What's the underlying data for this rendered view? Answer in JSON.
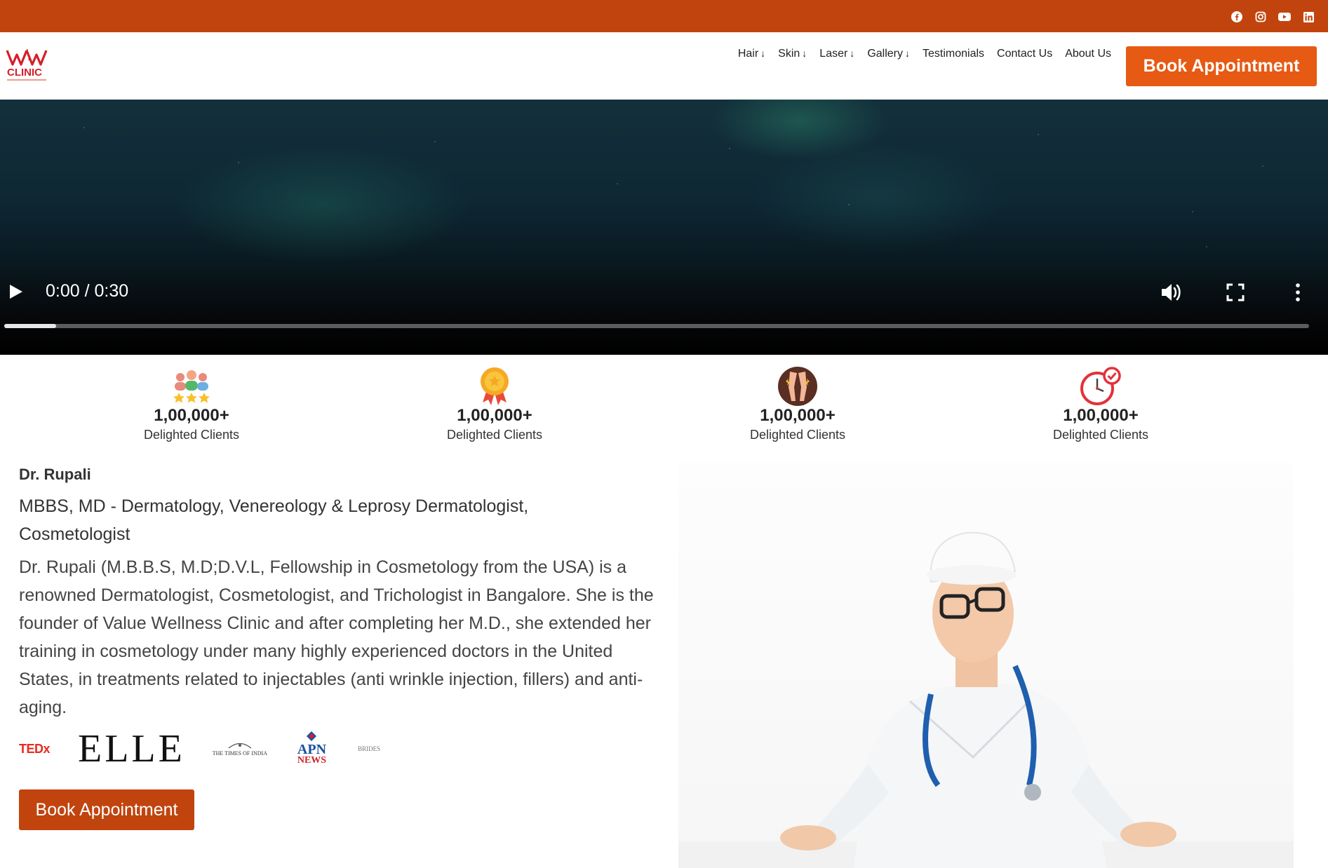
{
  "top_bar": {
    "color": "#c1440e",
    "social_icons": [
      "facebook-icon",
      "instagram-icon",
      "youtube-icon",
      "linkedin-icon"
    ]
  },
  "header": {
    "logo_text": "VW CLINIC",
    "nav": [
      {
        "label": "Hair",
        "dropdown": true
      },
      {
        "label": "Skin",
        "dropdown": true
      },
      {
        "label": "Laser",
        "dropdown": true
      },
      {
        "label": "Gallery",
        "dropdown": true
      },
      {
        "label": "Testimonials",
        "dropdown": false
      },
      {
        "label": "Contact Us",
        "dropdown": false
      },
      {
        "label": "About Us",
        "dropdown": false
      }
    ],
    "dropdown_arrow": "↓",
    "book_button": "Book Appointment",
    "accent": "#e65a14"
  },
  "video": {
    "time": "0:00 / 0:30",
    "progress": 0.04
  },
  "stats": [
    {
      "value": "1,00,000+",
      "label": "Delighted Clients",
      "icon": "clients-stars-icon"
    },
    {
      "value": "1,00,000+",
      "label": "Delighted Clients",
      "icon": "medal-icon"
    },
    {
      "value": "1,00,000+",
      "label": "Delighted Clients",
      "icon": "legs-icon"
    },
    {
      "value": "1,00,000+",
      "label": "Delighted Clients",
      "icon": "clock-check-icon"
    }
  ],
  "doctor": {
    "name": "Dr. Rupali",
    "qualification": "MBBS, MD - Dermatology, Venereology & Leprosy Dermatologist, Cosmetologist",
    "bio": "Dr. Rupali (M.B.B.S, M.D;D.V.L, Fellowship in Cosmetology from the USA) is a renowned Dermatologist, Cosmetologist, and Trichologist in Bangalore. She is the founder of Value Wellness Clinic and after completing her M.D., she extended her training in cosmetology under many highly experienced doctors in the United States, in treatments related to injectables (anti wrinkle injection, fillers) and anti-aging.",
    "book_button": "Book Appointment"
  },
  "media_logos": {
    "tedx": "TEDx",
    "elle": "ELLE",
    "toi": "THE TIMES OF INDIA",
    "apn_top": "APN",
    "apn_bottom": "NEWS",
    "brides": "BRIDES"
  }
}
